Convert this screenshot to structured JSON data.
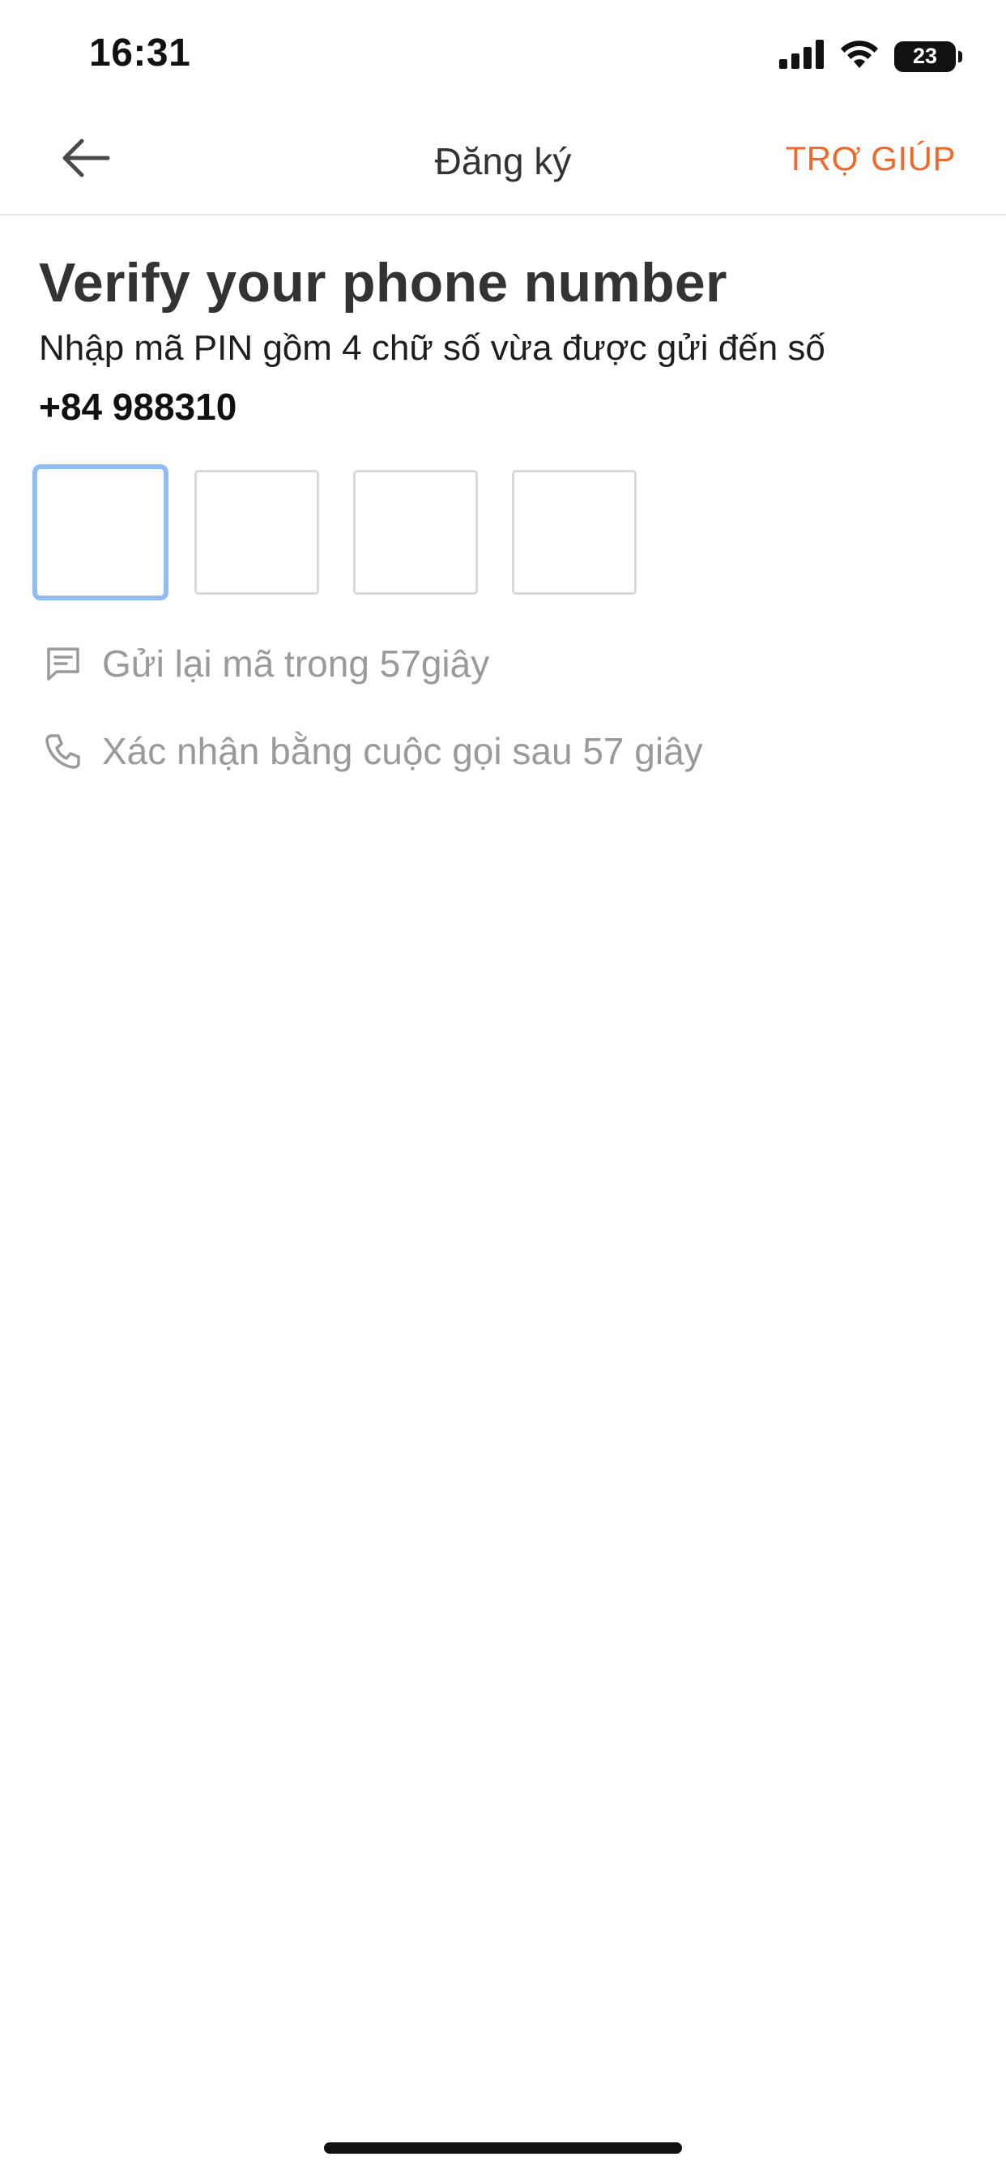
{
  "status_bar": {
    "time": "16:31",
    "battery": "23",
    "signal_icon": "cellular-signal-icon",
    "wifi_icon": "wifi-icon"
  },
  "nav": {
    "back_icon": "arrow-left-icon",
    "title": "Đăng ký",
    "help_label": "TRỢ GIÚP"
  },
  "content": {
    "title": "Verify your phone number",
    "instruction": "Nhập mã PIN gồm 4 chữ số vừa được gửi đến số",
    "phone_number": "+84 988310",
    "pin_digits": [
      "",
      "",
      "",
      ""
    ],
    "resend": {
      "icon": "message-icon",
      "text": "Gửi lại mã trong 57giây"
    },
    "call": {
      "icon": "phone-icon",
      "text": "Xác nhận bằng cuộc gọi sau 57 giây"
    }
  },
  "colors": {
    "accent": "#ee6a2c",
    "focus_border": "#8fbcf2",
    "box_border": "#d9d9d9",
    "muted_text": "#9a9a9a"
  }
}
